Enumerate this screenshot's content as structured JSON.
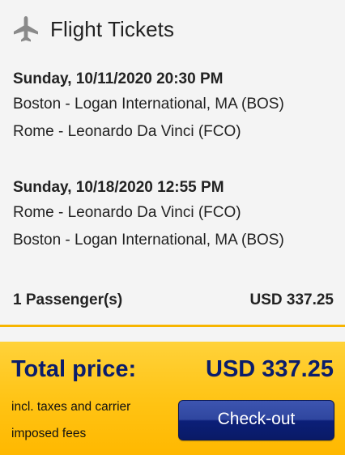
{
  "header": {
    "icon": "airplane-icon",
    "title": "Flight Tickets"
  },
  "legs": [
    {
      "datetime": "Sunday, 10/11/2020 20:30 PM",
      "from": "Boston - Logan International, MA (BOS)",
      "to": "Rome - Leonardo Da Vinci (FCO)"
    },
    {
      "datetime": "Sunday, 10/18/2020 12:55 PM",
      "from": "Rome - Leonardo Da Vinci (FCO)",
      "to": "Boston - Logan International, MA (BOS)"
    }
  ],
  "summary": {
    "passengers": "1 Passenger(s)",
    "subtotal": "USD 337.25"
  },
  "total": {
    "label": "Total price:",
    "amount": "USD 337.25",
    "note": "incl. taxes and carrier imposed fees",
    "checkout_label": "Check-out"
  },
  "colors": {
    "accent_yellow": "#ffc313",
    "price_blue": "#0b1d6b",
    "button_blue": "#0b1f78"
  }
}
